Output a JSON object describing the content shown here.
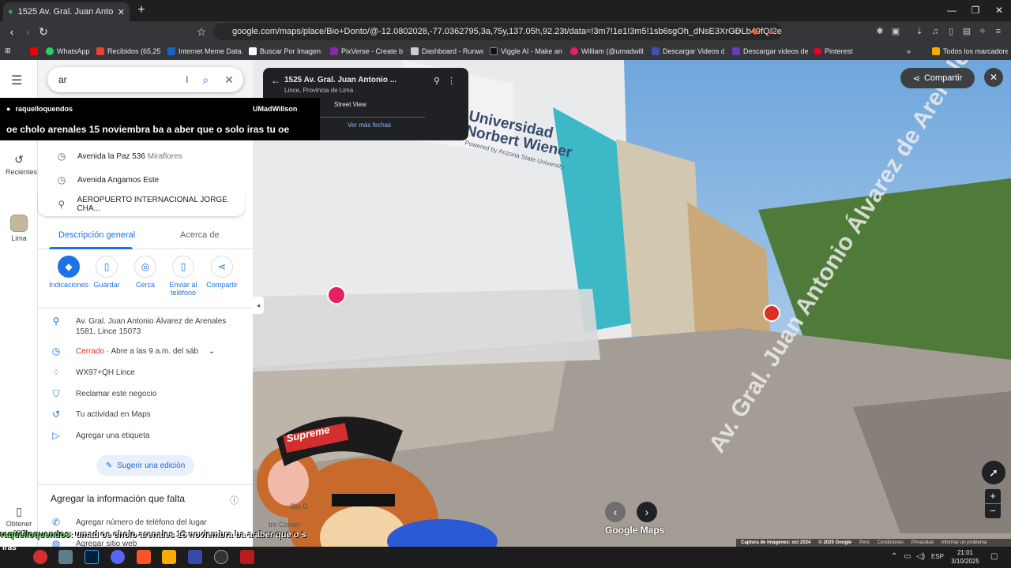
{
  "browser": {
    "tab_title": "1525 Av. Gral. Juan Antonio Álva",
    "url": "google.com/maps/place/Bio+Donto/@-12.0802028,-77.0362795,3a,75y,137.05h,92.23t/data=!3m7!1e1!3m5!1sb6sgOh_dNsE3XrGDLb49fQ!2e0!6shtt...",
    "bookmarks": [
      {
        "label": "WhatsApp",
        "color": "#25d366"
      },
      {
        "label": "Recibidos (65,255)",
        "color": "#ea4335"
      },
      {
        "label": "Internet Meme Data...",
        "color": "#1565c0"
      },
      {
        "label": "Buscar Por Imagen -...",
        "color": "#ffffff"
      },
      {
        "label": "PixVerse - Create br...",
        "color": "#8e24aa"
      },
      {
        "label": "Dashboard - Runway",
        "color": "#cccccc"
      },
      {
        "label": "Viggle AI - Make an...",
        "color": "#111111"
      },
      {
        "label": "William (@umadwill...",
        "color": "#e91e63"
      },
      {
        "label": "Descargar Videos d...",
        "color": "#3f51b5"
      },
      {
        "label": "Descargar videos de...",
        "color": "#673ab7"
      },
      {
        "label": "Pinterest",
        "color": "#e60023"
      }
    ],
    "all_bookmarks": "Todos los marcadores"
  },
  "rail": {
    "recents": "Recientes",
    "lima": "Lima",
    "get_app": "Obtener app"
  },
  "search": {
    "value": "ar"
  },
  "suggestions": [
    {
      "main": "Avenida la Paz 536",
      "sub": "Miraflores",
      "icon": "clock-icon"
    },
    {
      "main": "Avenida Angamos Este",
      "sub": "",
      "icon": "clock-icon"
    },
    {
      "main": "AEROPUERTO INTERNACIONAL JORGE CHA...",
      "sub": "",
      "icon": "pin-icon"
    }
  ],
  "tabs": {
    "overview": "Descripción general",
    "about": "Acerca de"
  },
  "actions": [
    "Indicaciones",
    "Guardar",
    "Cerca",
    "Enviar al teléfono",
    "Compartir"
  ],
  "info": {
    "address": "Av. Gral. Juan Antonio Álvarez de Arenales 1581, Lince 15073",
    "status": "Cerrado",
    "hours": "· Abre a las 9 a.m. del sáb",
    "pluscode": "WX97+QH Lince",
    "claim": "Reclamar este negocio",
    "activity": "Tu actividad en Maps",
    "label": "Agregar una etiqueta",
    "suggest": "Sugerir una edición",
    "missing_title": "Agregar la información que falta",
    "add_phone": "Agregar número de teléfono del lugar",
    "add_web": "Agregar sitio web"
  },
  "streetview_card": {
    "title": "1525 Av. Gral. Juan Antonio ...",
    "subtitle": "Lince, Provincia de Lima",
    "sv_label": "Street View",
    "more_dates": "Ver más fechas"
  },
  "chat_overlay": {
    "user": "raquelloquendos",
    "streamer": "UMadWillson",
    "message": "oe cholo arenales 15 noviembra ba a aber que o solo iras tu oe"
  },
  "bottom_chat": {
    "user": "raquelloquendos",
    "message": ": umad oe cholo arenales 15 noviembra ba a aber que o s"
  },
  "map": {
    "share": "Compartir",
    "building_text": "Universidad Norbert Wiener",
    "building_sub": "Powered by Arizona State University",
    "street_label": "Av. Gral. Juan Antonio Álvarez de Arenales",
    "brand": "Google Maps",
    "footer": [
      "Captura de imágenes: oct 2024",
      "© 2025 Google",
      "Perú",
      "Condiciones",
      "Privacidad",
      "Informar un problema"
    ],
    "meme_hat": "Supreme",
    "bio_label": "Bio D",
    "corner": "tro Comer"
  },
  "taskbar": {
    "time": "21:01",
    "date": "3/10/2025",
    "lang": "ESP",
    "iras": "iras"
  }
}
